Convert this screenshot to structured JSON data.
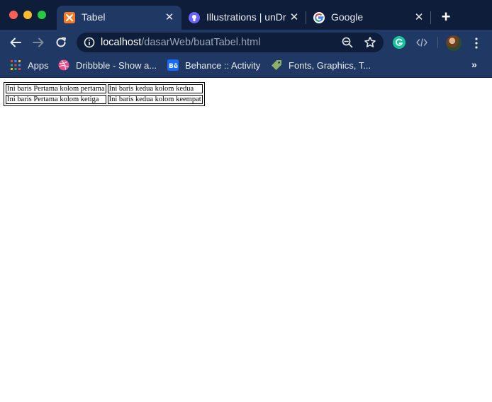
{
  "browser": {
    "tabs": [
      {
        "title": "Tabel",
        "icon": "xampp-icon",
        "active": true
      },
      {
        "title": "Illustrations | unDraw",
        "icon": "undraw-icon",
        "active": false
      },
      {
        "title": "Google",
        "icon": "google-icon",
        "active": false
      }
    ],
    "url": {
      "host": "localhost",
      "path": "/dasarWeb/buatTabel.html"
    },
    "bookmarks": [
      {
        "label": "Apps",
        "icon": "apps-grid-icon"
      },
      {
        "label": "Dribbble - Show a...",
        "icon": "dribbble-icon"
      },
      {
        "label": "Behance :: Activity",
        "icon": "behance-icon"
      },
      {
        "label": "Fonts, Graphics, T...",
        "icon": "tag-icon"
      }
    ],
    "colors": {
      "frame": "#0e1e3a",
      "toolbar": "#1f3864"
    }
  },
  "page": {
    "table": [
      [
        "Ini baris Pertama kolom pertama",
        "Ini baris kedua kolom kedua"
      ],
      [
        "Ini baris Pertama kolom ketiga",
        "Ini baris kedua kolom keempat"
      ]
    ]
  }
}
